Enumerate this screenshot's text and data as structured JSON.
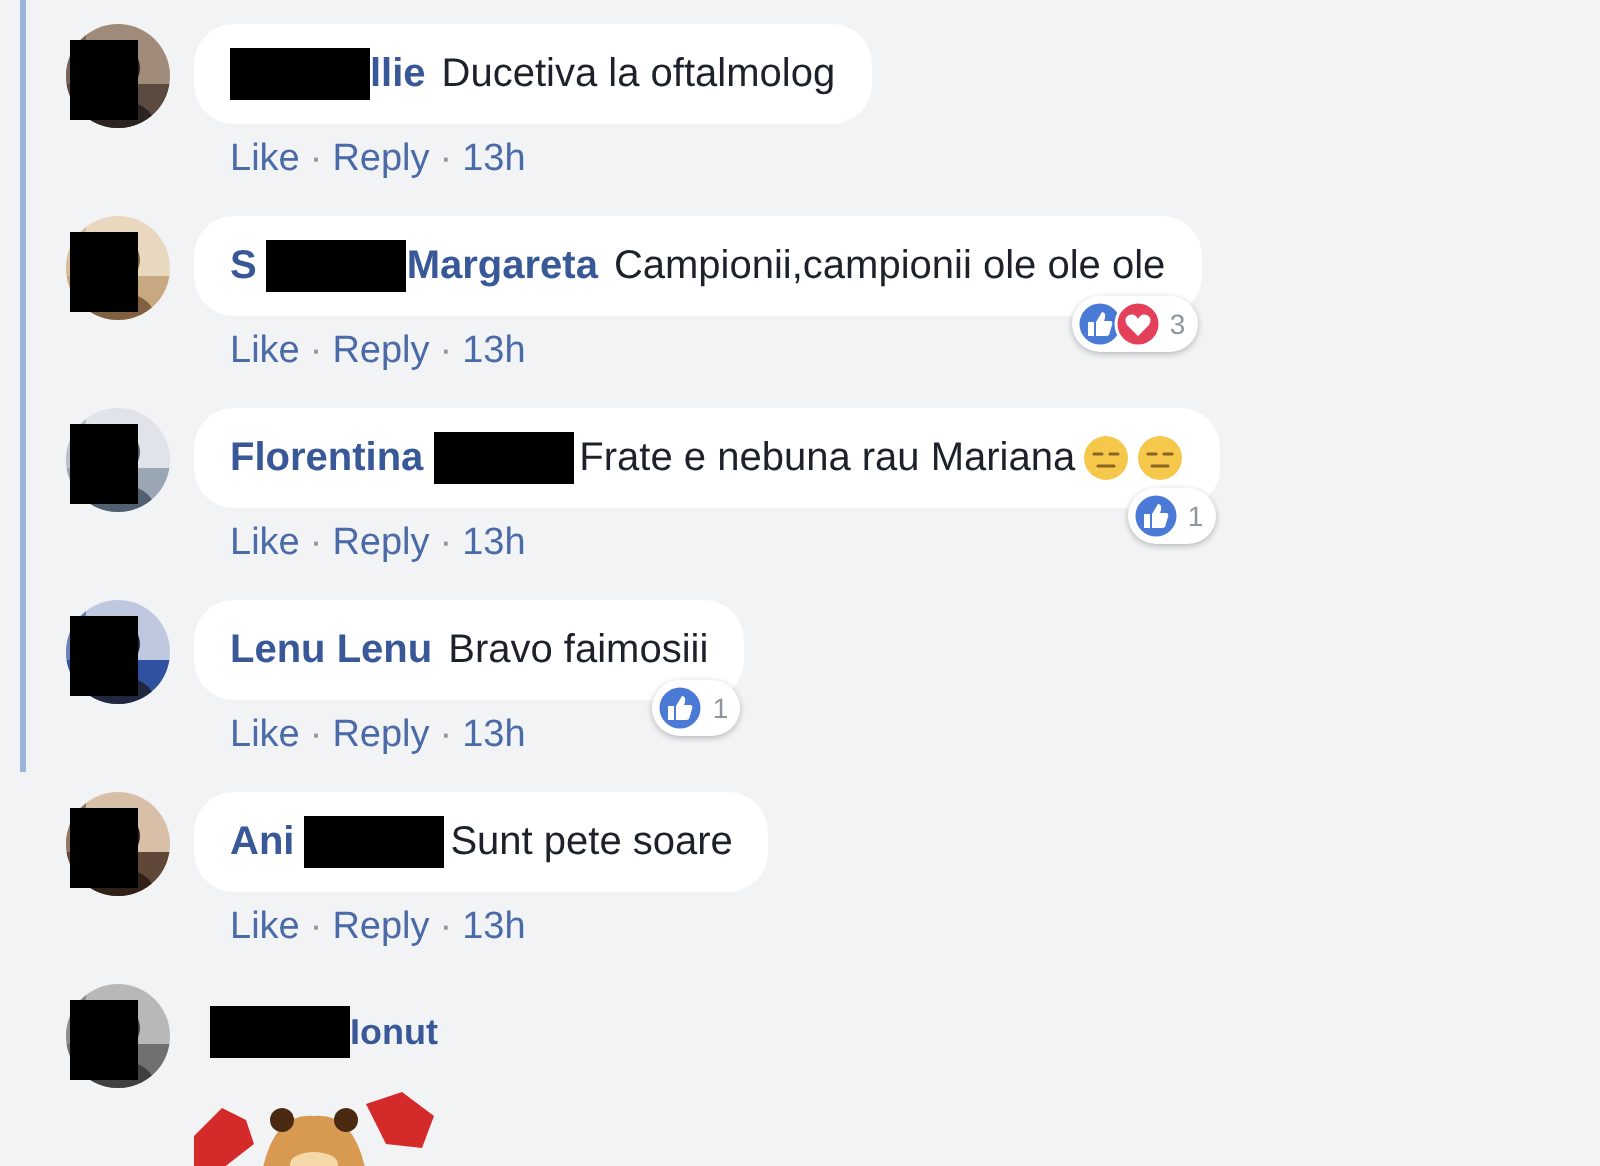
{
  "separator": "·",
  "comments": [
    {
      "author_parts": [
        {
          "kind": "redaction"
        },
        {
          "kind": "text",
          "text": "llie"
        }
      ],
      "text": "Ducetiva la oftalmolog",
      "actions": [
        "Like",
        "Reply"
      ],
      "time": "13h"
    },
    {
      "author_parts": [
        {
          "kind": "text",
          "text": "S"
        },
        {
          "kind": "redaction"
        },
        {
          "kind": "text",
          "text": "Margareta"
        }
      ],
      "text": "Campionii,campionii ole ole ole",
      "actions": [
        "Like",
        "Reply"
      ],
      "time": "13h",
      "reactions": {
        "icons": [
          {
            "kind": "like"
          },
          {
            "kind": "love"
          }
        ],
        "count": "3"
      }
    },
    {
      "author_parts": [
        {
          "kind": "text",
          "text": "Florentina"
        },
        {
          "kind": "redaction"
        }
      ],
      "text": "Frate e nebuna rau Mariana",
      "emojis": [
        {
          "kind": "expressionless"
        },
        {
          "kind": "expressionless"
        }
      ],
      "actions": [
        "Like",
        "Reply"
      ],
      "time": "13h",
      "reactions": {
        "icons": [
          {
            "kind": "like"
          }
        ],
        "count": "1"
      }
    },
    {
      "author_parts": [
        {
          "kind": "text",
          "text": "Lenu Lenu"
        }
      ],
      "text": "Bravo faimosiii",
      "actions": [
        "Like",
        "Reply"
      ],
      "time": "13h",
      "reactions": {
        "icons": [
          {
            "kind": "like"
          }
        ],
        "count": "1"
      }
    },
    {
      "author_parts": [
        {
          "kind": "text",
          "text": "Ani"
        },
        {
          "kind": "redaction"
        }
      ],
      "text": "Sunt pete soare",
      "actions": [
        "Like",
        "Reply"
      ],
      "time": "13h"
    },
    {
      "author_parts": [
        {
          "kind": "redaction"
        },
        {
          "kind": "text",
          "text": "Ionut"
        }
      ],
      "sticker": {
        "kind": "picture"
      }
    }
  ]
}
